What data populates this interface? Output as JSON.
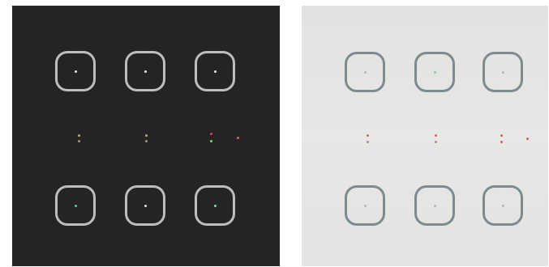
{
  "panels": [
    {
      "theme": "dark",
      "background": "#242326",
      "frame_color": "#bdbdbd",
      "buttons": [
        {
          "id": "top-left",
          "led_color": "#e6e6e6"
        },
        {
          "id": "top-center",
          "led_color": "#e6e6e6"
        },
        {
          "id": "top-right",
          "led_color": "#e6e6e6"
        },
        {
          "id": "bottom-left",
          "led_color": "#4fd49a"
        },
        {
          "id": "bottom-center",
          "led_color": "#e6e6e6"
        },
        {
          "id": "bottom-right",
          "led_color": "#7fe0a8"
        }
      ],
      "indicator_colors": [
        "#c9a06a",
        "#9a9a6a",
        "#d64a4a",
        "#8fd04f",
        "#c96a6a"
      ]
    },
    {
      "theme": "light",
      "background": "#e5e5e3",
      "frame_color": "#7d8b8f",
      "buttons": [
        {
          "id": "top-left",
          "led_color": "#b0b5b6"
        },
        {
          "id": "top-center",
          "led_color": "#9fc2b0"
        },
        {
          "id": "top-right",
          "led_color": "#b0b5b6"
        },
        {
          "id": "bottom-left",
          "led_color": "#b0b5b6"
        },
        {
          "id": "bottom-center",
          "led_color": "#b0b5b6"
        },
        {
          "id": "bottom-right",
          "led_color": "#b0b5b6"
        }
      ],
      "indicator_colors": [
        "#e05a6a",
        "#b08a8a",
        "#e05a6a",
        "#e05a6a",
        "#e05a6a"
      ]
    }
  ]
}
